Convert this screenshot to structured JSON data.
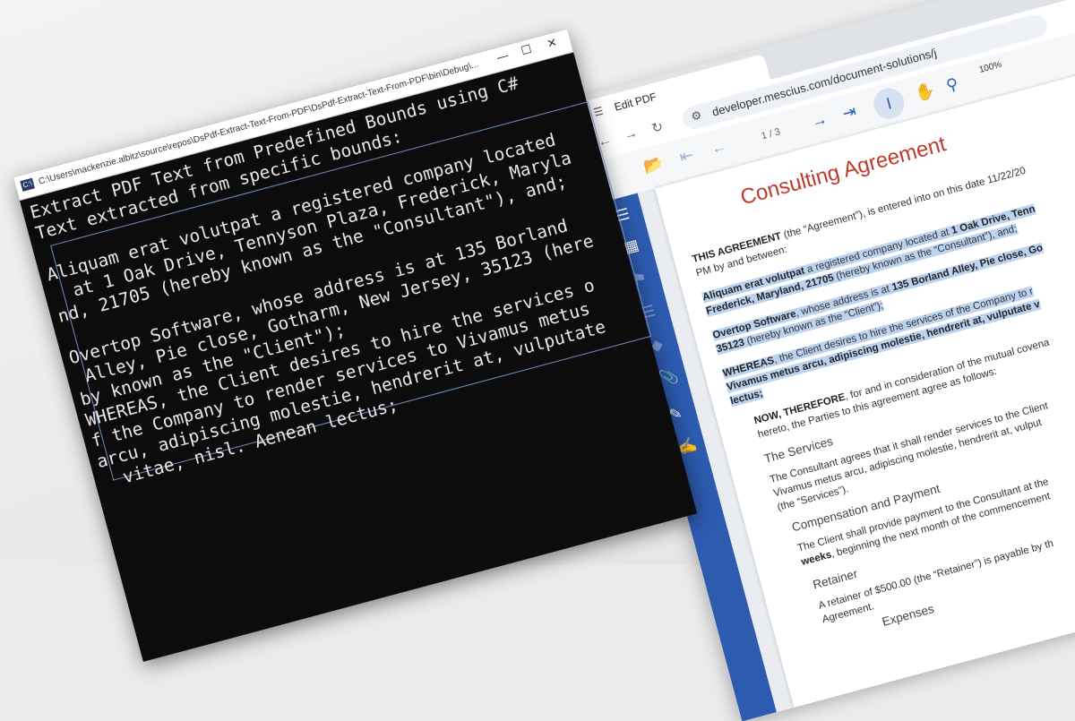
{
  "browser": {
    "tab_title": "Edit PDF",
    "url": "developer.mescius.com/document-solutions/j",
    "toolbar": {
      "page_indicator": "1 / 3",
      "zoom_value": "100%"
    },
    "document": {
      "title": "Consulting Agreement",
      "line1": ", is entered into on this date 11/22/20",
      "line1_lead": "THIS AGREEMENT",
      "line1_mid": " (the “Agreement”)",
      "line2": "PM by and between:",
      "para1_a_bold": "Aliquam erat volutpat",
      "para1_a_rest": " a registered company located at ",
      "para1_a_bold2": "1 Oak Drive, Tenn",
      "para1_b_bold": "Frederick, Maryland, 21705",
      "para1_b_rest": " (hereby known as the “Consultant”), and;",
      "para2_a_bold": "Overtop Software",
      "para2_a_rest": ", whose address is at ",
      "para2_a_bold2": "135 Borland Alley, Pie close, Go",
      "para2_b_bold": "35123",
      "para2_b_rest": " (hereby known as the “Client”);",
      "para3_a_bold": "WHEREAS",
      "para3_a_rest": ", the Client desires to hire the services of the Company to r",
      "para3_b_bold": "Vivamus metus arcu, adipiscing molestie, hendrerit at, vulputate v",
      "para3_c_bold": "lectus;",
      "para4_a_bold": "NOW, THEREFORE",
      "para4_a_rest": ", for and in consideration of the mutual covena",
      "para4_b": "hereto, the Parties to this agreement agree as follows:",
      "h_services": "The Services",
      "services_a": "The Consultant agrees that it shall render services to the Client",
      "services_b": "Vivamus metus arcu, adipiscing molestie, hendrerit at, vulput",
      "services_c": "(the “Services”).",
      "h_comp": "Compensation and Payment",
      "comp_a": "The Client shall provide payment to the Consultant at the",
      "comp_b_bold": "weeks",
      "comp_b_rest": ", beginning the next month of the commencement",
      "h_retainer": "Retainer",
      "retainer_a": "A retainer of $500.00 (the “Retainer”) is payable by th",
      "retainer_b": "Agreement.",
      "h_expenses": "Expenses"
    }
  },
  "console": {
    "title_path": "C:\\Users\\mackenzie.albitz\\source\\repos\\DsPdf-Extract-Text-From-PDF\\DsPdf-Extract-Text-From-PDF\\bin\\Debug\\...",
    "lines": [
      "Extract PDF Text from Predefined Bounds using C#",
      "Text extracted from specific bounds:",
      "",
      "Aliquam erat volutpat a registered company located",
      "  at 1 Oak Drive, Tennyson Plaza, Frederick, Maryla",
      "nd, 21705 (hereby known as the \"Consultant\"), and;",
      "",
      "Overtop Software, whose address is at 135 Borland",
      " Alley, Pie close, Gotharm, New Jersey, 35123 (here",
      "by known as the \"Client\");",
      "WHEREAS, the Client desires to hire the services o",
      "f the Company to render services to Vivamus metus",
      "arcu, adipiscing molestie, hendrerit at, vulputate",
      "  vitae, nisl. Aenean lectus;"
    ]
  }
}
